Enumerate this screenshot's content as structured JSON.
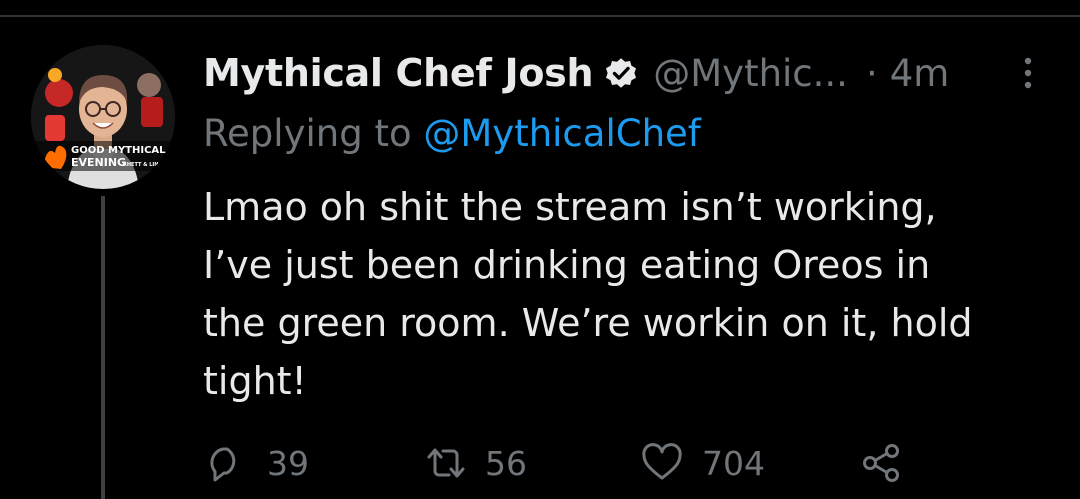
{
  "tweet": {
    "author": {
      "display_name": "Mythical Chef Josh",
      "handle": "@Mythic...",
      "avatar_text_top": "GOOD MYTHICAL",
      "avatar_text_bottom": "EVENING",
      "avatar_text_side": "RHETT & LINK"
    },
    "separator": "·",
    "time": "4m",
    "replying_prefix": "Replying to",
    "replying_to": "@MythicalChef",
    "text": "Lmao oh shit the stream isn’t working,\nI’ve just been drinking eating Oreos in\nthe green room. We’re workin on it, hold\ntight!",
    "counts": {
      "replies": "39",
      "retweets": "56",
      "likes": "704"
    }
  },
  "icons": {
    "verified": "verified-badge-icon",
    "more": "more-vertical-icon",
    "reply": "reply-icon",
    "retweet": "retweet-icon",
    "like": "heart-icon",
    "share": "share-icon"
  },
  "colors": {
    "background": "#000000",
    "text": "#e7e9ea",
    "secondary": "#71767b",
    "link": "#1d9bf0",
    "thread_line": "#3e4144"
  }
}
